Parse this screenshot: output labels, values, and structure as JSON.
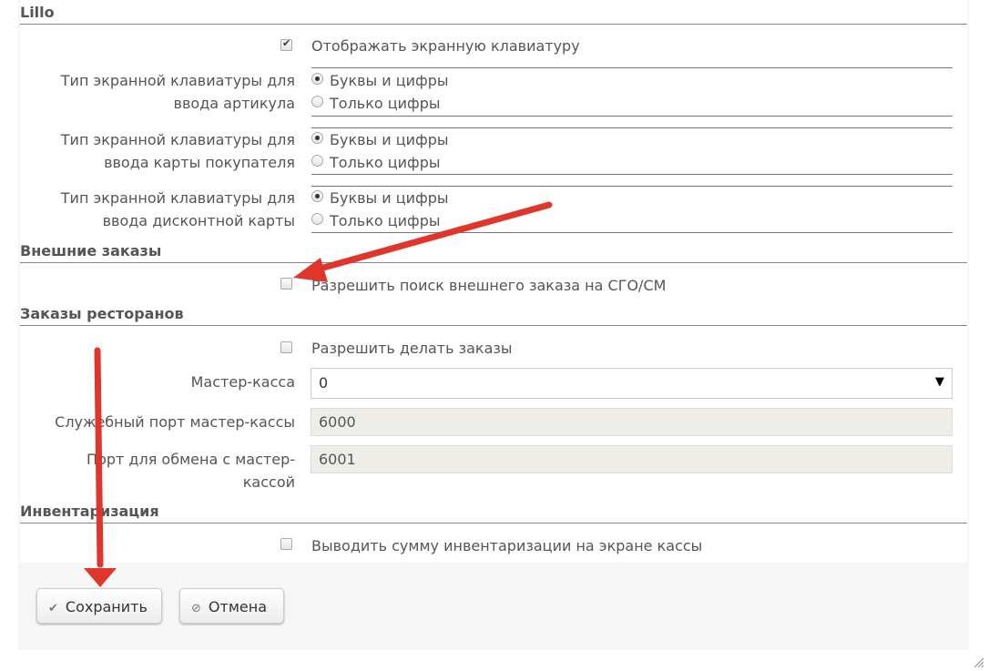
{
  "sections": {
    "lillo": {
      "title": "Lillo",
      "show_keyboard": "Отображать экранную клавиатуру",
      "article_label_1": "Тип экранной клавиатуры для",
      "article_label_2": "ввода артикула",
      "card_label_1": "Тип экранной клавиатуры для",
      "card_label_2": "ввода карты покупателя",
      "discount_label_1": "Тип экранной клавиатуры для",
      "discount_label_2": "ввода дисконтной карты",
      "opt_letters": "Буквы и цифры",
      "opt_digits": "Только цифры"
    },
    "external": {
      "title": "Внешние заказы",
      "allow_search": "Разрешить поиск внешнего заказа на СГО/СМ"
    },
    "restaurant": {
      "title": "Заказы ресторанов",
      "allow_orders": "Разрешить делать заказы",
      "master_label": "Мастер-касса",
      "master_value": "0",
      "service_port_label": "Служебный порт мастер-кассы",
      "service_port_value": "6000",
      "exchange_port_label_1": "Порт для обмена с мастер-",
      "exchange_port_label_2": "кассой",
      "exchange_port_value": "6001"
    },
    "inventory": {
      "title": "Инвентаризация",
      "show_sum": "Выводить сумму инвентаризации на экране кассы"
    }
  },
  "buttons": {
    "save": "Сохранить",
    "cancel": "Отмена"
  },
  "icons": {
    "select_arrow": "▼",
    "save_icon": "✔",
    "cancel_icon": "⊘"
  },
  "colors": {
    "annotation_arrow": "#e0352b"
  }
}
